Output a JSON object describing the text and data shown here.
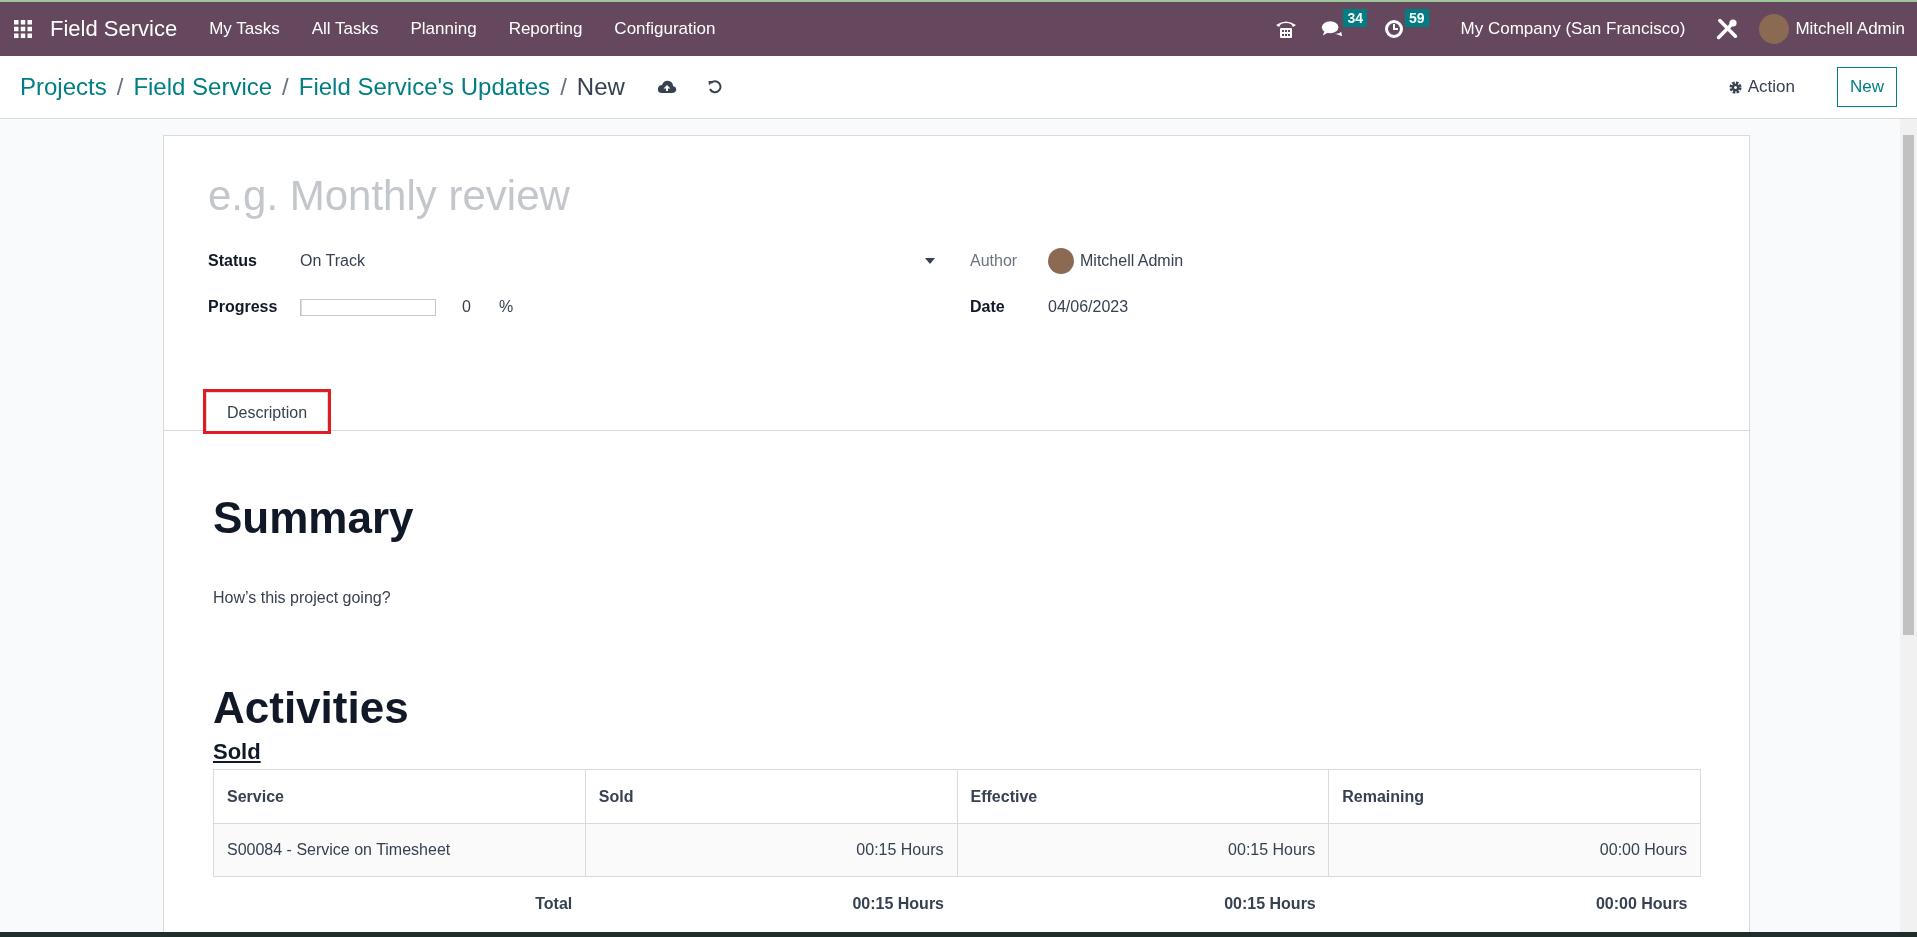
{
  "navbar": {
    "app_name": "Field Service",
    "menu": [
      "My Tasks",
      "All Tasks",
      "Planning",
      "Reporting",
      "Configuration"
    ],
    "messages_count": "34",
    "activities_count": "59",
    "company": "My Company (San Francisco)",
    "user": "Mitchell Admin"
  },
  "control_panel": {
    "breadcrumbs": [
      {
        "label": "Projects",
        "separator": "/"
      },
      {
        "label": "Field Service",
        "separator": "/"
      },
      {
        "label": "Field Service's Updates",
        "separator": "/"
      }
    ],
    "current": "New",
    "action": "Action",
    "new_button": "New"
  },
  "form": {
    "name_placeholder": "e.g. Monthly review",
    "status": {
      "label": "Status",
      "value": "On Track"
    },
    "progress": {
      "label": "Progress",
      "level": 0,
      "value": "0",
      "unit": "%"
    },
    "author": {
      "label": "Author",
      "value": "Mitchell Admin"
    },
    "date": {
      "label": "Date",
      "value": "04/06/2023"
    },
    "tabs": [
      {
        "label": "Description",
        "selected": true,
        "highlighted": true
      }
    ],
    "summary_heading": "Summary",
    "summary_text": "How’s this project going?",
    "activities_heading": "Activities",
    "sold_heading": "Sold",
    "table": {
      "columns": [
        "Service",
        "Sold",
        "Effective",
        "Remaining"
      ],
      "rows": [
        [
          "S00084 - Service on Timesheet",
          "00:15 Hours",
          "00:15 Hours",
          "00:00 Hours"
        ]
      ],
      "total": [
        "Total",
        "00:15 Hours",
        "00:15 Hours",
        "00:00 Hours"
      ]
    }
  }
}
